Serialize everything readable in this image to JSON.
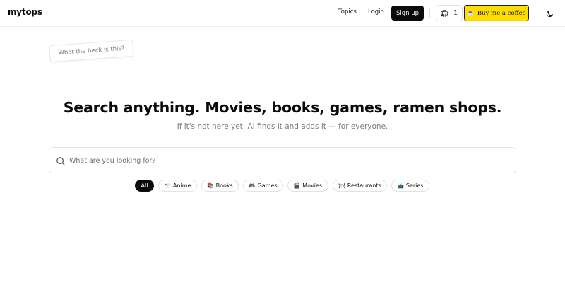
{
  "header": {
    "logo": "mytops",
    "nav": {
      "topics": "Topics",
      "login": "Login"
    },
    "signup_label": "Sign up",
    "github": {
      "icon": "github-icon",
      "count": "1"
    },
    "coffee": {
      "icon": "☕",
      "label": "Buy me a coffee"
    },
    "theme_icon": "moon-icon"
  },
  "note": {
    "text": "What the heck is this?"
  },
  "hero": {
    "title": "Search anything. Movies, books, games, ramen shops.",
    "subtitle": "If it's not here yet, AI finds it and adds it — for everyone."
  },
  "search": {
    "placeholder": "What are you looking for?",
    "value": "",
    "icon": "search-icon"
  },
  "categories": [
    {
      "label": "All",
      "icon": "",
      "active": true
    },
    {
      "label": "Anime",
      "icon": "🎌",
      "active": false
    },
    {
      "label": "Books",
      "icon": "📚",
      "active": false
    },
    {
      "label": "Games",
      "icon": "🎮",
      "active": false
    },
    {
      "label": "Movies",
      "icon": "🎬",
      "active": false
    },
    {
      "label": "Restaurants",
      "icon": "🍽",
      "active": false
    },
    {
      "label": "Series",
      "icon": "📺",
      "active": false
    }
  ],
  "colors": {
    "accent_dark": "#0b0b0b",
    "coffee_yellow": "#ffdd00",
    "border": "#e3e3e3",
    "muted_text": "#7a7a7a"
  }
}
